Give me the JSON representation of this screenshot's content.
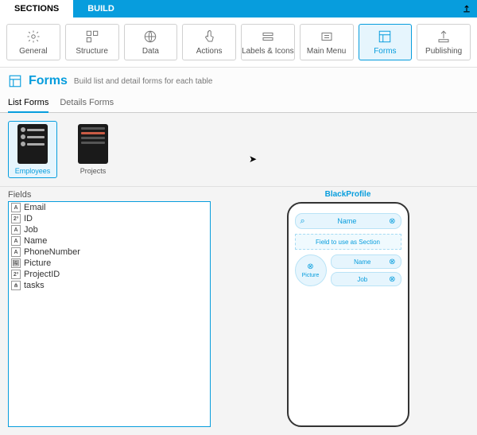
{
  "topbar": {
    "tab_sections": "SECTIONS",
    "tab_build": "BUILD"
  },
  "toolbar": {
    "general": "General",
    "structure": "Structure",
    "data": "Data",
    "actions": "Actions",
    "labels": "Labels & Icons",
    "mainmenu": "Main Menu",
    "forms": "Forms",
    "publishing": "Publishing"
  },
  "section": {
    "title": "Forms",
    "subtitle": "Build list and detail forms for each table"
  },
  "form_tabs": {
    "list": "List Forms",
    "details": "Details Forms"
  },
  "cards": {
    "employees": "Employees",
    "projects": "Projects"
  },
  "fields": {
    "title": "Fields",
    "items": [
      {
        "type": "A",
        "name": "Email"
      },
      {
        "type": "2³",
        "name": "ID"
      },
      {
        "type": "A",
        "name": "Job"
      },
      {
        "type": "A",
        "name": "Name"
      },
      {
        "type": "A",
        "name": "PhoneNumber"
      },
      {
        "type": "🖼",
        "name": "Picture"
      },
      {
        "type": "2³",
        "name": "ProjectID"
      },
      {
        "type": "⋔",
        "name": "tasks"
      }
    ]
  },
  "preview": {
    "title": "BlackProfile",
    "search_field": "Name",
    "section_placeholder": "Field to use as Section",
    "pic_label": "Picture",
    "slot1": "Name",
    "slot2": "Job"
  }
}
